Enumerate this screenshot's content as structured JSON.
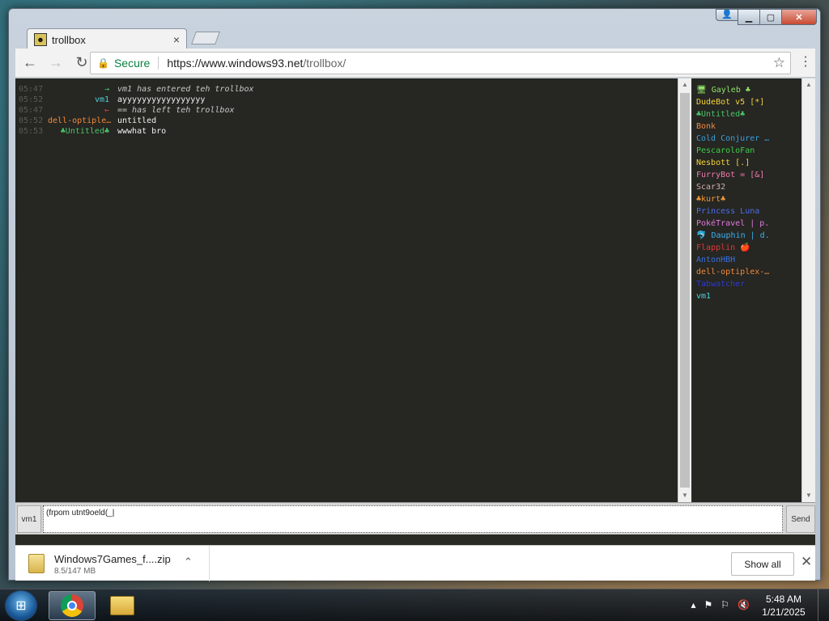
{
  "browser": {
    "tab_title": "trollbox",
    "tab_close": "×",
    "secure_label": "Secure",
    "url_host": "https://www.windows93.net",
    "url_path": "/trollbox/"
  },
  "chat": {
    "messages": [
      {
        "time": "05:47",
        "nick": "→",
        "nick_color": "#45c97a",
        "text": "vm1 has entered teh trollbox",
        "system": true
      },
      {
        "time": "05:52",
        "nick": "vm1",
        "nick_color": "#4fd0d8",
        "text": "ayyyyyyyyyyyyyyyyy",
        "system": false
      },
      {
        "time": "05:47",
        "nick": "←",
        "nick_color": "#e04a4a",
        "text": "== has left teh trollbox",
        "system": true
      },
      {
        "time": "05:52",
        "nick": "dell-optiple…",
        "nick_color": "#f08a3c",
        "text": "untitled",
        "system": false
      },
      {
        "time": "05:53",
        "nick": "♣Untitled♣",
        "nick_color": "#4cc46a",
        "text": "wwwhat   bro",
        "system": false
      }
    ]
  },
  "users": [
    {
      "name": "🖥 Gayleb ♣",
      "color": "#8fe06a"
    },
    {
      "name": "DudeBot v5 [*]",
      "color": "#f4d43a"
    },
    {
      "name": "♣Untitled♣",
      "color": "#4cc46a"
    },
    {
      "name": "Bonk",
      "color": "#f08a3c"
    },
    {
      "name": "Cold Conjurer …",
      "color": "#3aa0e0"
    },
    {
      "name": "PescaroloFan",
      "color": "#3ad048"
    },
    {
      "name": "Nesbott [.]",
      "color": "#f4d43a"
    },
    {
      "name": "FurryBot = [&]",
      "color": "#f07ab0"
    },
    {
      "name": "Scar32",
      "color": "#d0b0b0"
    },
    {
      "name": "♣kurt♣",
      "color": "#f09a3a"
    },
    {
      "name": "Princess Luna",
      "color": "#4a6ef0"
    },
    {
      "name": "PokéTravel | p.",
      "color": "#e07ae0"
    },
    {
      "name": "🐬 Dauphin | d.",
      "color": "#3ab0f0"
    },
    {
      "name": "Flapplin 🍎",
      "color": "#e03a3a"
    },
    {
      "name": "AntonHBH",
      "color": "#3a70e0"
    },
    {
      "name": "dell-optiplex-…",
      "color": "#f08a3c"
    },
    {
      "name": "Tabwatcher",
      "color": "#2a3ad0"
    },
    {
      "name": "vm1",
      "color": "#4fd0d8"
    }
  ],
  "input": {
    "channel_label": "vm1",
    "value": "(frpom utnt9oeld(_|",
    "send_label": "Send"
  },
  "downloads": {
    "file_name": "Windows7Games_f....zip",
    "file_size": "8.5/147 MB",
    "show_all_label": "Show all"
  },
  "taskbar": {
    "time": "5:48 AM",
    "date": "1/21/2025"
  }
}
